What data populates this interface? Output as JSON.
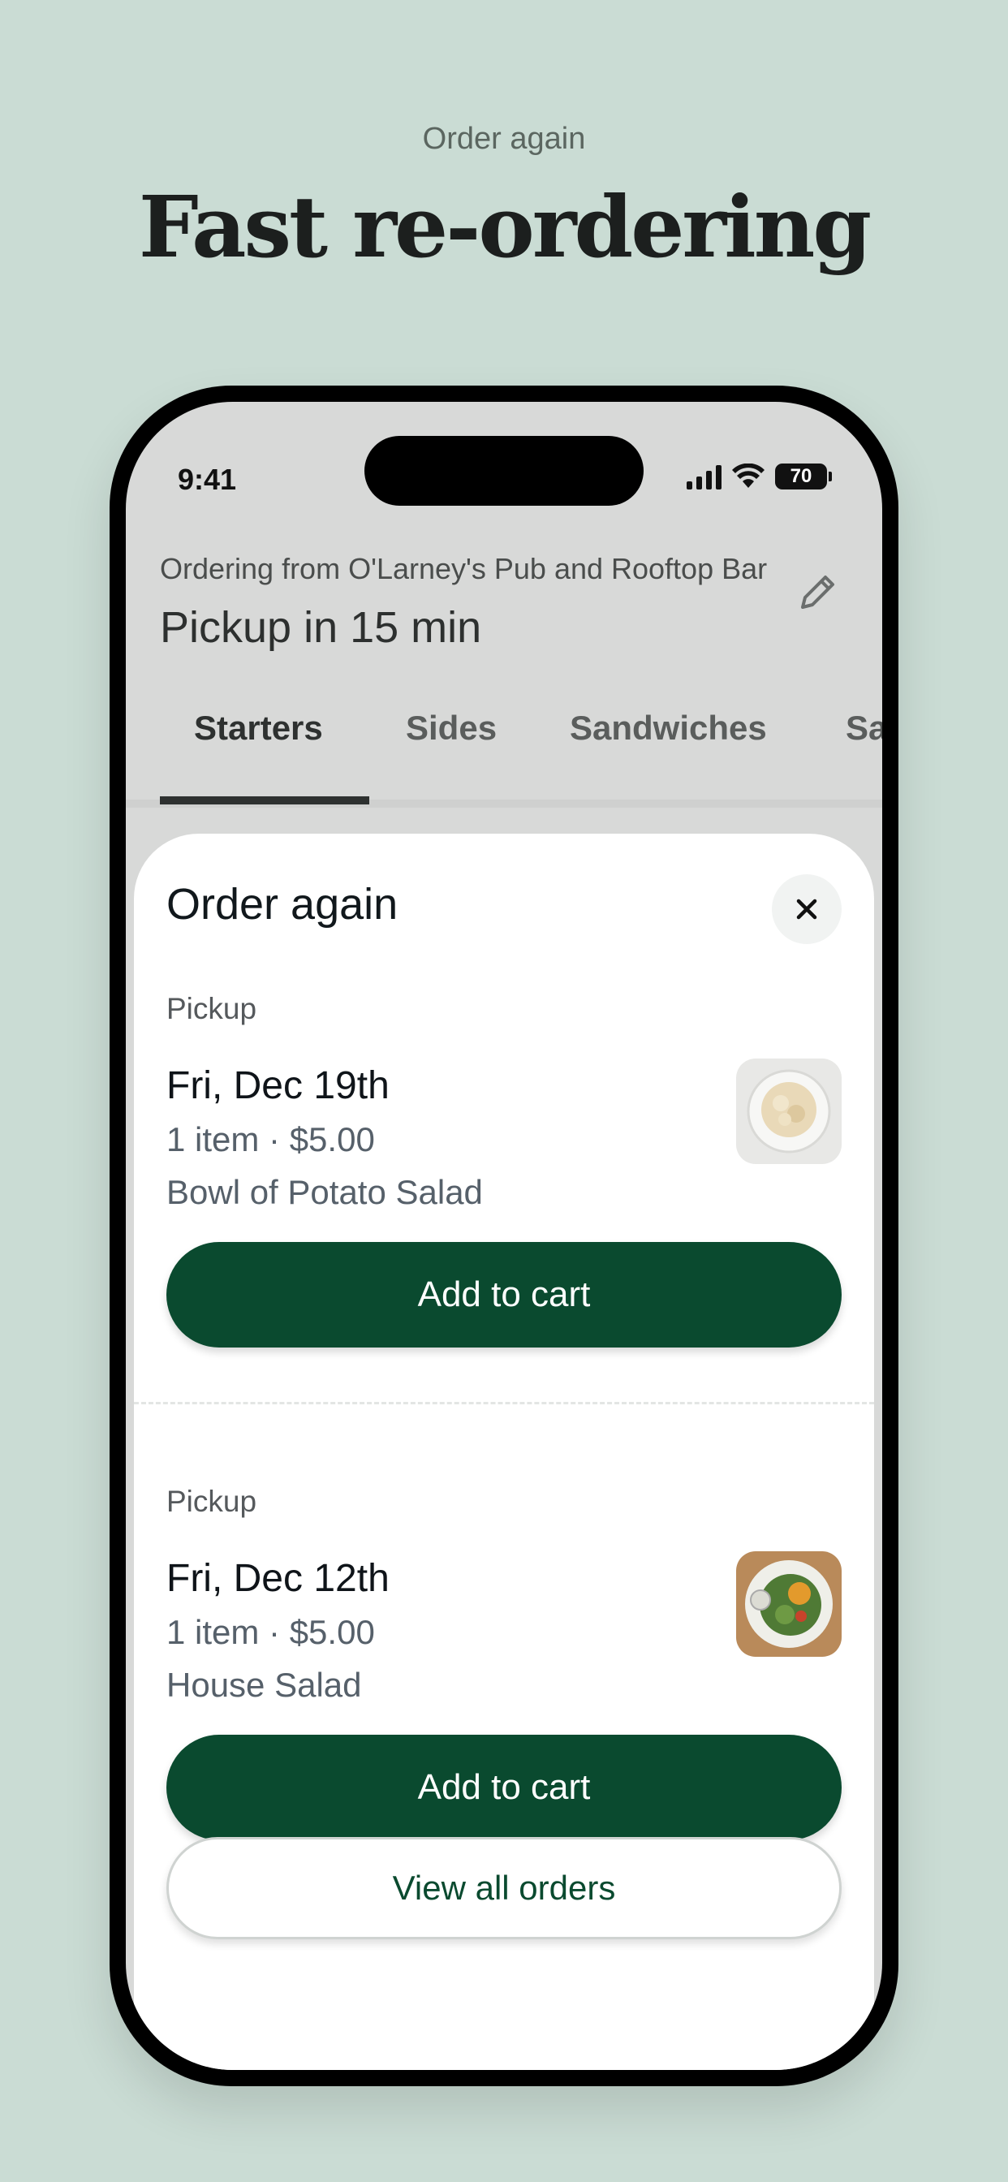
{
  "promo": {
    "eyebrow": "Order again",
    "title": "Fast re-ordering"
  },
  "status_bar": {
    "time": "9:41",
    "battery": "70"
  },
  "header": {
    "ordering_from": "Ordering from O'Larney's Pub and Rooftop Bar",
    "pickup_title": "Pickup in 15 min",
    "edit_icon": "pencil-icon"
  },
  "tabs": [
    {
      "label": "Starters"
    },
    {
      "label": "Sides"
    },
    {
      "label": "Sandwiches"
    },
    {
      "label": "Sa"
    }
  ],
  "sheet": {
    "title": "Order again",
    "close_icon": "close-icon",
    "orders": [
      {
        "type": "Pickup",
        "date": "Fri, Dec 19th",
        "summary": "1 item · $5.00",
        "item": "Bowl of Potato Salad",
        "button": "Add to cart"
      },
      {
        "type": "Pickup",
        "date": "Fri, Dec 12th",
        "summary": "1 item · $5.00",
        "item": "House Salad",
        "button": "Add to cart"
      }
    ],
    "view_all": "View all orders"
  },
  "colors": {
    "background": "#cadcd4",
    "primary": "#0a4a2f"
  }
}
